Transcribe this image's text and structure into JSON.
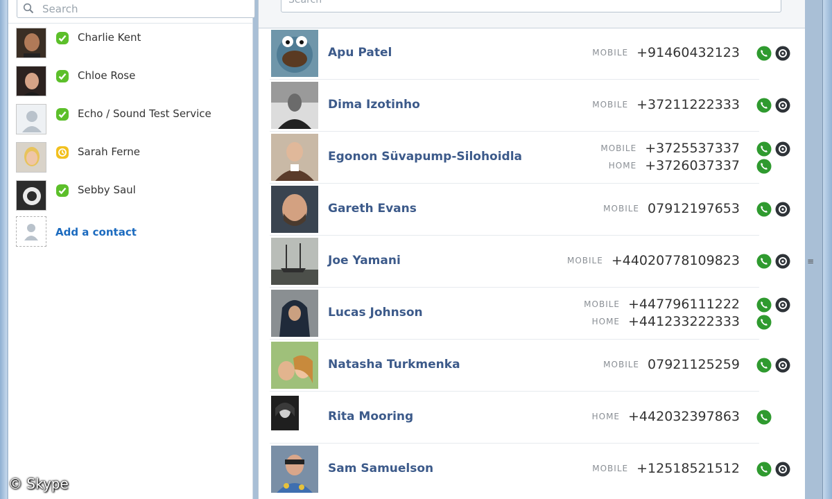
{
  "left": {
    "search_placeholder": "Search",
    "contacts": [
      {
        "name": "Charlie Kent",
        "status": "online"
      },
      {
        "name": "Chloe Rose",
        "status": "online"
      },
      {
        "name": "Echo / Sound Test Service",
        "status": "online"
      },
      {
        "name": "Sarah Ferne",
        "status": "away"
      },
      {
        "name": "Sebby Saul",
        "status": "online"
      }
    ],
    "add_contact_label": "Add a contact"
  },
  "right": {
    "search_placeholder": "Search",
    "rows": [
      {
        "name": "Apu Patel",
        "phones": [
          {
            "type": "MOBILE",
            "number": "+91460432123"
          }
        ]
      },
      {
        "name": "Dima Izotinho",
        "phones": [
          {
            "type": "MOBILE",
            "number": "+37211222333"
          }
        ]
      },
      {
        "name": "Egonon Süvapump-Silohoidla",
        "phones": [
          {
            "type": "MOBILE",
            "number": "+3725537337"
          },
          {
            "type": "HOME",
            "number": "+3726037337"
          }
        ]
      },
      {
        "name": "Gareth Evans",
        "phones": [
          {
            "type": "MOBILE",
            "number": "07912197653"
          }
        ]
      },
      {
        "name": "Joe Yamani",
        "phones": [
          {
            "type": "MOBILE",
            "number": "+44020778109823"
          }
        ]
      },
      {
        "name": "Lucas Johnson",
        "phones": [
          {
            "type": "MOBILE",
            "number": "+447796111222"
          },
          {
            "type": "HOME",
            "number": "+441233222333"
          }
        ]
      },
      {
        "name": "Natasha Turkmenka",
        "phones": [
          {
            "type": "MOBILE",
            "number": "07921125259"
          }
        ]
      },
      {
        "name": "Rita Mooring",
        "phones": [
          {
            "type": "HOME",
            "number": "+442032397863"
          }
        ]
      },
      {
        "name": "Sam Samuelson",
        "phones": [
          {
            "type": "MOBILE",
            "number": "+12518521512"
          }
        ]
      }
    ]
  },
  "watermark": "© Skype",
  "colors": {
    "status_online": "#5cbf2a",
    "status_away": "#f2c01e",
    "call_green": "#2f9a2f",
    "name_blue": "#3c5a8a",
    "link_blue": "#1c6bbf"
  }
}
